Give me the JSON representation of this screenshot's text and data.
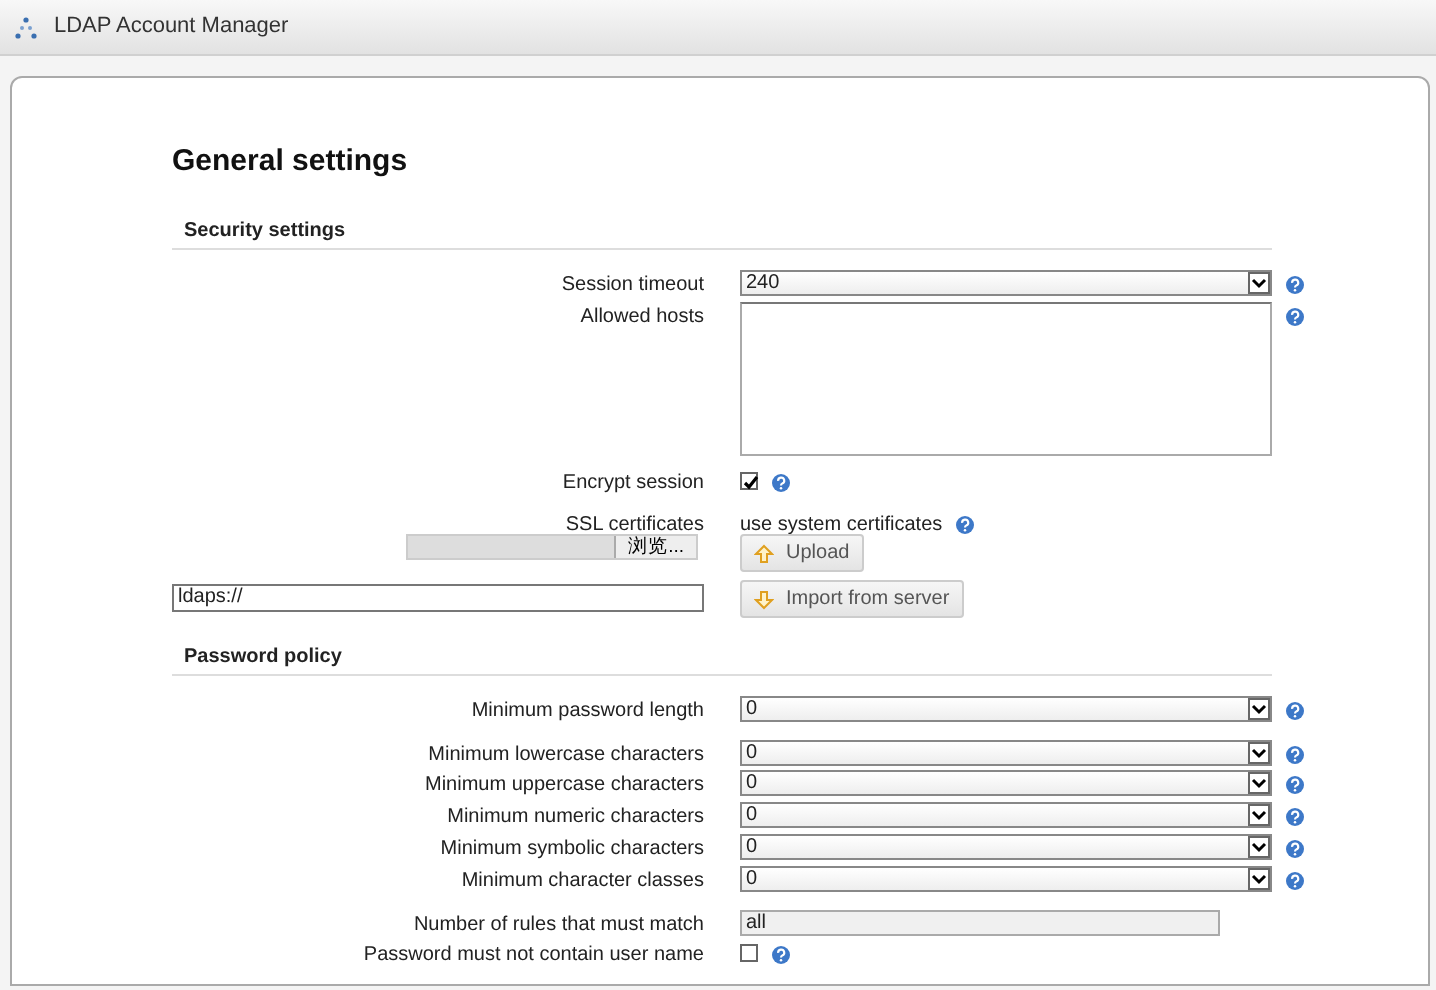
{
  "app_title": "LDAP Account Manager",
  "page_title": "General settings",
  "sections": [
    {
      "title": "Security settings",
      "rows": [
        {
          "kind": "select",
          "label": "Session timeout",
          "value": "240",
          "help": true
        },
        {
          "kind": "textarea",
          "label": "Allowed hosts",
          "help": true
        },
        {
          "kind": "checkbox",
          "label": "Encrypt session",
          "checked": true,
          "help": true,
          "space_before": true
        },
        {
          "kind": "info",
          "label": "SSL certificates",
          "text": "use system certificates",
          "help": true,
          "space_before": true
        },
        {
          "kind": "file",
          "browse_label": "浏览...",
          "button": {
            "label": "Upload"
          }
        },
        {
          "kind": "url",
          "value": "ldaps://",
          "button": {
            "label": "Import from server"
          }
        }
      ]
    },
    {
      "title": "Password policy",
      "rows": [
        {
          "kind": "select",
          "label": "Minimum password length",
          "value": "0",
          "help": true
        },
        {
          "kind": "select",
          "label": "Minimum lowercase characters",
          "value": "0",
          "help": true,
          "space_before": true
        },
        {
          "kind": "select",
          "label": "Minimum uppercase characters",
          "value": "0",
          "help": true
        },
        {
          "kind": "select",
          "label": "Minimum numeric characters",
          "value": "0",
          "help": true
        },
        {
          "kind": "select",
          "label": "Minimum symbolic characters",
          "value": "0",
          "help": true
        },
        {
          "kind": "select",
          "label": "Minimum character classes",
          "value": "0",
          "help": true
        },
        {
          "kind": "text",
          "label": "Number of rules that must match",
          "value": "all",
          "help": false,
          "space_before": true
        },
        {
          "kind": "checkbox",
          "label": "Password must not contain user name",
          "checked": false,
          "help": true
        }
      ]
    }
  ]
}
